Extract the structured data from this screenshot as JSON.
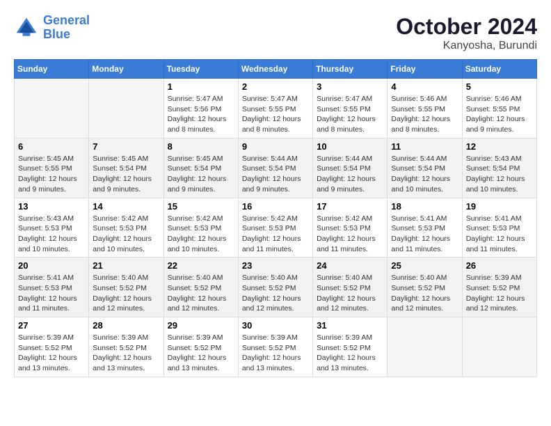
{
  "header": {
    "logo_line1": "General",
    "logo_line2": "Blue",
    "month": "October 2024",
    "location": "Kanyosha, Burundi"
  },
  "weekdays": [
    "Sunday",
    "Monday",
    "Tuesday",
    "Wednesday",
    "Thursday",
    "Friday",
    "Saturday"
  ],
  "weeks": [
    [
      {
        "day": "",
        "sunrise": "",
        "sunset": "",
        "daylight": ""
      },
      {
        "day": "",
        "sunrise": "",
        "sunset": "",
        "daylight": ""
      },
      {
        "day": "1",
        "sunrise": "Sunrise: 5:47 AM",
        "sunset": "Sunset: 5:56 PM",
        "daylight": "Daylight: 12 hours and 8 minutes."
      },
      {
        "day": "2",
        "sunrise": "Sunrise: 5:47 AM",
        "sunset": "Sunset: 5:55 PM",
        "daylight": "Daylight: 12 hours and 8 minutes."
      },
      {
        "day": "3",
        "sunrise": "Sunrise: 5:47 AM",
        "sunset": "Sunset: 5:55 PM",
        "daylight": "Daylight: 12 hours and 8 minutes."
      },
      {
        "day": "4",
        "sunrise": "Sunrise: 5:46 AM",
        "sunset": "Sunset: 5:55 PM",
        "daylight": "Daylight: 12 hours and 8 minutes."
      },
      {
        "day": "5",
        "sunrise": "Sunrise: 5:46 AM",
        "sunset": "Sunset: 5:55 PM",
        "daylight": "Daylight: 12 hours and 9 minutes."
      }
    ],
    [
      {
        "day": "6",
        "sunrise": "Sunrise: 5:45 AM",
        "sunset": "Sunset: 5:55 PM",
        "daylight": "Daylight: 12 hours and 9 minutes."
      },
      {
        "day": "7",
        "sunrise": "Sunrise: 5:45 AM",
        "sunset": "Sunset: 5:54 PM",
        "daylight": "Daylight: 12 hours and 9 minutes."
      },
      {
        "day": "8",
        "sunrise": "Sunrise: 5:45 AM",
        "sunset": "Sunset: 5:54 PM",
        "daylight": "Daylight: 12 hours and 9 minutes."
      },
      {
        "day": "9",
        "sunrise": "Sunrise: 5:44 AM",
        "sunset": "Sunset: 5:54 PM",
        "daylight": "Daylight: 12 hours and 9 minutes."
      },
      {
        "day": "10",
        "sunrise": "Sunrise: 5:44 AM",
        "sunset": "Sunset: 5:54 PM",
        "daylight": "Daylight: 12 hours and 9 minutes."
      },
      {
        "day": "11",
        "sunrise": "Sunrise: 5:44 AM",
        "sunset": "Sunset: 5:54 PM",
        "daylight": "Daylight: 12 hours and 10 minutes."
      },
      {
        "day": "12",
        "sunrise": "Sunrise: 5:43 AM",
        "sunset": "Sunset: 5:54 PM",
        "daylight": "Daylight: 12 hours and 10 minutes."
      }
    ],
    [
      {
        "day": "13",
        "sunrise": "Sunrise: 5:43 AM",
        "sunset": "Sunset: 5:53 PM",
        "daylight": "Daylight: 12 hours and 10 minutes."
      },
      {
        "day": "14",
        "sunrise": "Sunrise: 5:42 AM",
        "sunset": "Sunset: 5:53 PM",
        "daylight": "Daylight: 12 hours and 10 minutes."
      },
      {
        "day": "15",
        "sunrise": "Sunrise: 5:42 AM",
        "sunset": "Sunset: 5:53 PM",
        "daylight": "Daylight: 12 hours and 10 minutes."
      },
      {
        "day": "16",
        "sunrise": "Sunrise: 5:42 AM",
        "sunset": "Sunset: 5:53 PM",
        "daylight": "Daylight: 12 hours and 11 minutes."
      },
      {
        "day": "17",
        "sunrise": "Sunrise: 5:42 AM",
        "sunset": "Sunset: 5:53 PM",
        "daylight": "Daylight: 12 hours and 11 minutes."
      },
      {
        "day": "18",
        "sunrise": "Sunrise: 5:41 AM",
        "sunset": "Sunset: 5:53 PM",
        "daylight": "Daylight: 12 hours and 11 minutes."
      },
      {
        "day": "19",
        "sunrise": "Sunrise: 5:41 AM",
        "sunset": "Sunset: 5:53 PM",
        "daylight": "Daylight: 12 hours and 11 minutes."
      }
    ],
    [
      {
        "day": "20",
        "sunrise": "Sunrise: 5:41 AM",
        "sunset": "Sunset: 5:53 PM",
        "daylight": "Daylight: 12 hours and 11 minutes."
      },
      {
        "day": "21",
        "sunrise": "Sunrise: 5:40 AM",
        "sunset": "Sunset: 5:52 PM",
        "daylight": "Daylight: 12 hours and 12 minutes."
      },
      {
        "day": "22",
        "sunrise": "Sunrise: 5:40 AM",
        "sunset": "Sunset: 5:52 PM",
        "daylight": "Daylight: 12 hours and 12 minutes."
      },
      {
        "day": "23",
        "sunrise": "Sunrise: 5:40 AM",
        "sunset": "Sunset: 5:52 PM",
        "daylight": "Daylight: 12 hours and 12 minutes."
      },
      {
        "day": "24",
        "sunrise": "Sunrise: 5:40 AM",
        "sunset": "Sunset: 5:52 PM",
        "daylight": "Daylight: 12 hours and 12 minutes."
      },
      {
        "day": "25",
        "sunrise": "Sunrise: 5:40 AM",
        "sunset": "Sunset: 5:52 PM",
        "daylight": "Daylight: 12 hours and 12 minutes."
      },
      {
        "day": "26",
        "sunrise": "Sunrise: 5:39 AM",
        "sunset": "Sunset: 5:52 PM",
        "daylight": "Daylight: 12 hours and 12 minutes."
      }
    ],
    [
      {
        "day": "27",
        "sunrise": "Sunrise: 5:39 AM",
        "sunset": "Sunset: 5:52 PM",
        "daylight": "Daylight: 12 hours and 13 minutes."
      },
      {
        "day": "28",
        "sunrise": "Sunrise: 5:39 AM",
        "sunset": "Sunset: 5:52 PM",
        "daylight": "Daylight: 12 hours and 13 minutes."
      },
      {
        "day": "29",
        "sunrise": "Sunrise: 5:39 AM",
        "sunset": "Sunset: 5:52 PM",
        "daylight": "Daylight: 12 hours and 13 minutes."
      },
      {
        "day": "30",
        "sunrise": "Sunrise: 5:39 AM",
        "sunset": "Sunset: 5:52 PM",
        "daylight": "Daylight: 12 hours and 13 minutes."
      },
      {
        "day": "31",
        "sunrise": "Sunrise: 5:39 AM",
        "sunset": "Sunset: 5:52 PM",
        "daylight": "Daylight: 12 hours and 13 minutes."
      },
      {
        "day": "",
        "sunrise": "",
        "sunset": "",
        "daylight": ""
      },
      {
        "day": "",
        "sunrise": "",
        "sunset": "",
        "daylight": ""
      }
    ]
  ]
}
